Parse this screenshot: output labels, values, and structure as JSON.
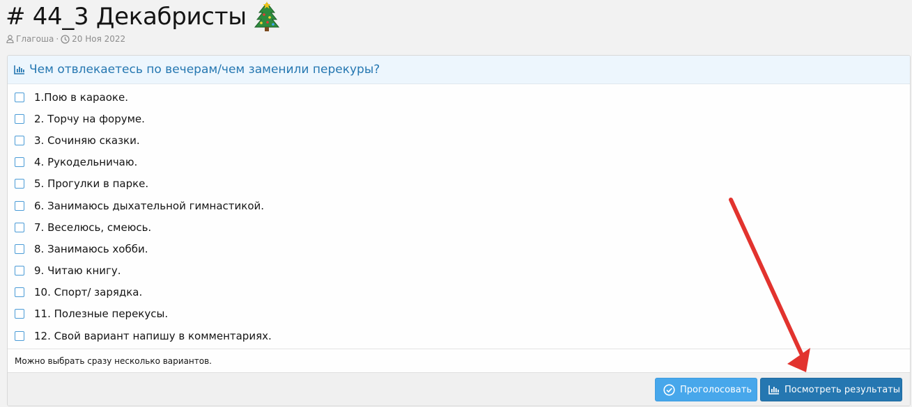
{
  "thread": {
    "title": "# 44_3 Декабристы",
    "author": "Глагоша",
    "separator": "·",
    "date": "20 Ноя 2022"
  },
  "poll": {
    "question": "Чем отвлекаетесь по вечерам/чем заменили перекуры?",
    "options": [
      "1.Пою в караоке.",
      "2. Торчу на форуме.",
      "3. Сочиняю сказки.",
      "4. Рукодельничаю.",
      "5. Прогулки в парке.",
      "6. Занимаюсь дыхательной гимнастикой.",
      "7. Веселюсь, смеюсь.",
      "8. Занимаюсь хобби.",
      "9. Читаю книгу.",
      "10. Спорт/ зарядка.",
      "11. Полезные перекусы.",
      "12. Свой вариант напишу в комментариях."
    ],
    "hint": "Можно выбрать сразу несколько вариантов.",
    "vote_label": "Проголосовать",
    "results_label": "Посмотреть результаты"
  },
  "colors": {
    "accent": "#2577b1",
    "vote_button": "#47a7eb",
    "header_bg": "#edf6fd",
    "arrow": "#e2332e"
  },
  "icons": {
    "title_emoji": "christmas-tree-icon",
    "author": "user-icon",
    "date": "clock-icon",
    "poll": "bar-chart-icon",
    "vote": "check-circle-icon",
    "results": "bar-chart-icon"
  }
}
